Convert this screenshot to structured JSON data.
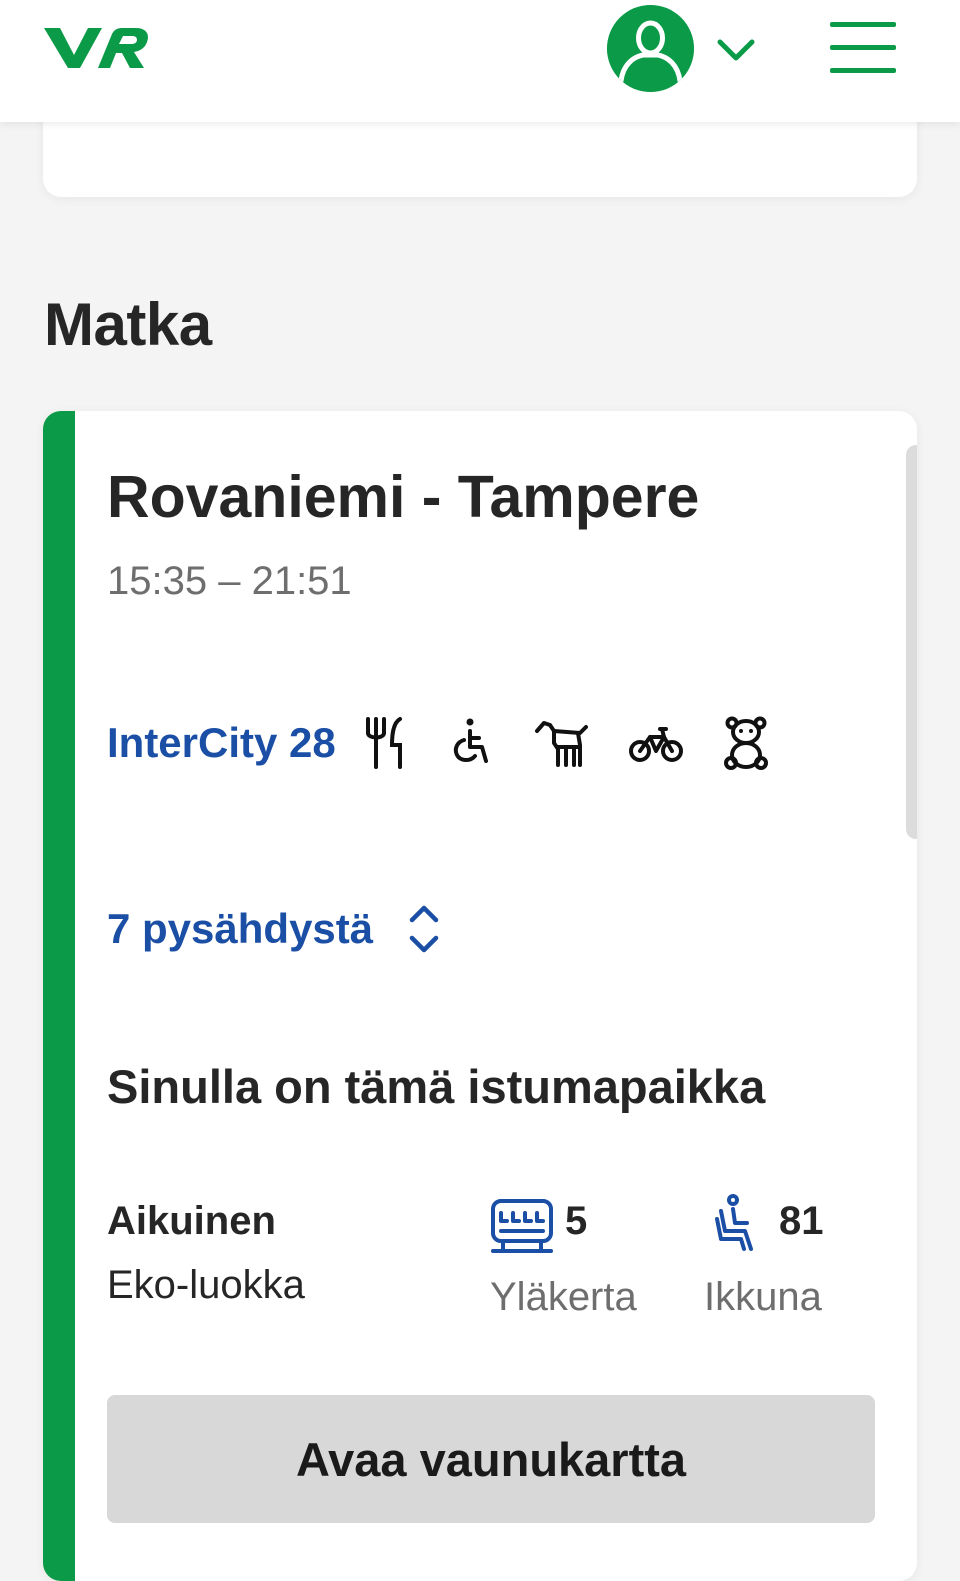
{
  "header": {
    "logo_text": "VR",
    "brand_color": "#0b9b48",
    "icons": [
      "vr-logo",
      "user-avatar-icon",
      "chevron-down-icon",
      "hamburger-menu-icon"
    ]
  },
  "section": {
    "title": "Matka"
  },
  "trip": {
    "route": "Rovaniemi - Tampere",
    "times": "15:35 – 21:51",
    "train": "InterCity 28",
    "services": [
      "restaurant-icon",
      "wheelchair-icon",
      "pet-icon",
      "bicycle-icon",
      "family-teddy-icon"
    ],
    "stops_label": "7 pysähdystä",
    "seat_heading": "Sinulla on tämä istumapaikka",
    "passenger_type": "Aikuinen",
    "ticket_class": "Eko-luokka",
    "wagon": {
      "number": "5",
      "label": "Yläkerta"
    },
    "seat": {
      "number": "81",
      "label": "Ikkuna"
    },
    "map_button_label": "Avaa vaunukartta"
  },
  "colors": {
    "accent_green": "#0b9b48",
    "link_blue": "#1b4fa6",
    "button_gray": "#d8d8d8"
  }
}
